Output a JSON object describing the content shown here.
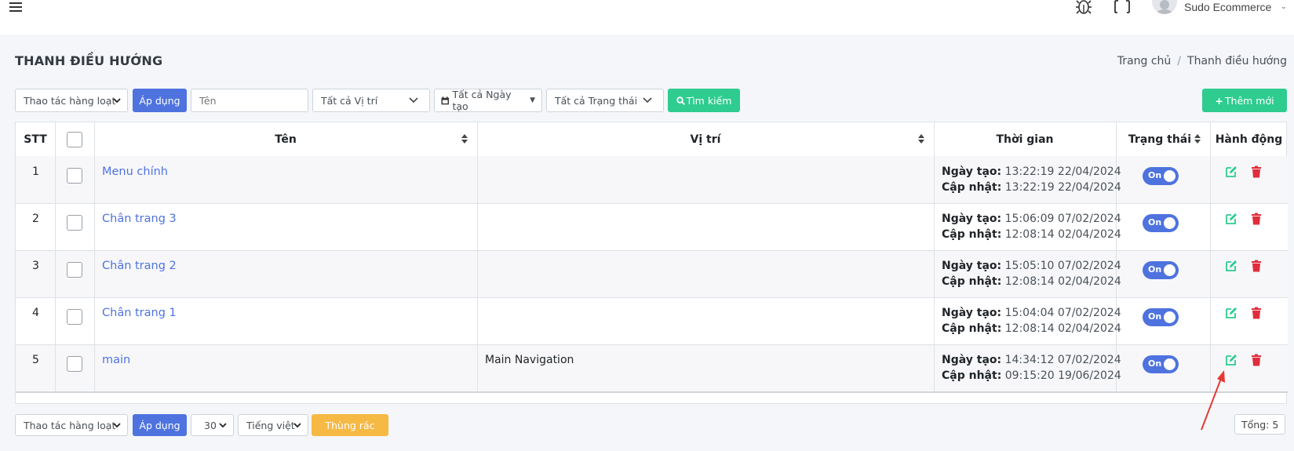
{
  "header": {
    "user_name": "Sudo Ecommerce"
  },
  "page": {
    "title": "THANH ĐIỀU HƯỚNG",
    "breadcrumb": {
      "home": "Trang chủ",
      "separator": "/",
      "current": "Thanh điều hướng"
    }
  },
  "toolbar": {
    "bulk_action": "Thao tác hàng loạt",
    "apply": "Áp dụng",
    "name_placeholder": "Tên",
    "position_filter": "Tất cả Vị trí",
    "date_filter": "Tất cả Ngày tạo",
    "status_filter": "Tất cả Trạng thái",
    "search": "Tìm kiếm",
    "add_new": "Thêm mới"
  },
  "table": {
    "headers": {
      "stt": "STT",
      "name": "Tên",
      "position": "Vị trí",
      "time": "Thời gian",
      "status": "Trạng thái",
      "action": "Hành động"
    },
    "created_label": "Ngày tạo:",
    "updated_label": "Cập nhật:",
    "rows": [
      {
        "stt": "1",
        "name": "Menu chính",
        "position": "",
        "created": "13:22:19 22/04/2024",
        "updated": "13:22:19 22/04/2024",
        "status": "On"
      },
      {
        "stt": "2",
        "name": "Chân trang 3",
        "position": "",
        "created": "15:06:09 07/02/2024",
        "updated": "12:08:14 02/04/2024",
        "status": "On"
      },
      {
        "stt": "3",
        "name": "Chân trang 2",
        "position": "",
        "created": "15:05:10 07/02/2024",
        "updated": "12:08:14 02/04/2024",
        "status": "On"
      },
      {
        "stt": "4",
        "name": "Chân trang 1",
        "position": "",
        "created": "15:04:04 07/02/2024",
        "updated": "12:08:14 02/04/2024",
        "status": "On"
      },
      {
        "stt": "5",
        "name": "main",
        "position": "Main Navigation",
        "created": "14:34:12 07/02/2024",
        "updated": "09:15:20 19/06/2024",
        "status": "On"
      }
    ]
  },
  "footer": {
    "bulk_action": "Thao tác hàng loạt",
    "apply": "Áp dụng",
    "per_page": "30",
    "language": "Tiếng việt",
    "trash": "Thùng rác",
    "total": "Tổng: 5"
  },
  "colors": {
    "primary": "#4e73df",
    "success": "#2ecc8f",
    "danger": "#e02d3c",
    "warning": "#f6b944",
    "annotation_arrow": "#e53935"
  },
  "icons": [
    "menu-icon",
    "bug-icon",
    "fullscreen-icon",
    "avatar",
    "calendar-icon",
    "search-icon",
    "plus-icon",
    "sort-icon",
    "edit-icon",
    "trash-icon"
  ]
}
